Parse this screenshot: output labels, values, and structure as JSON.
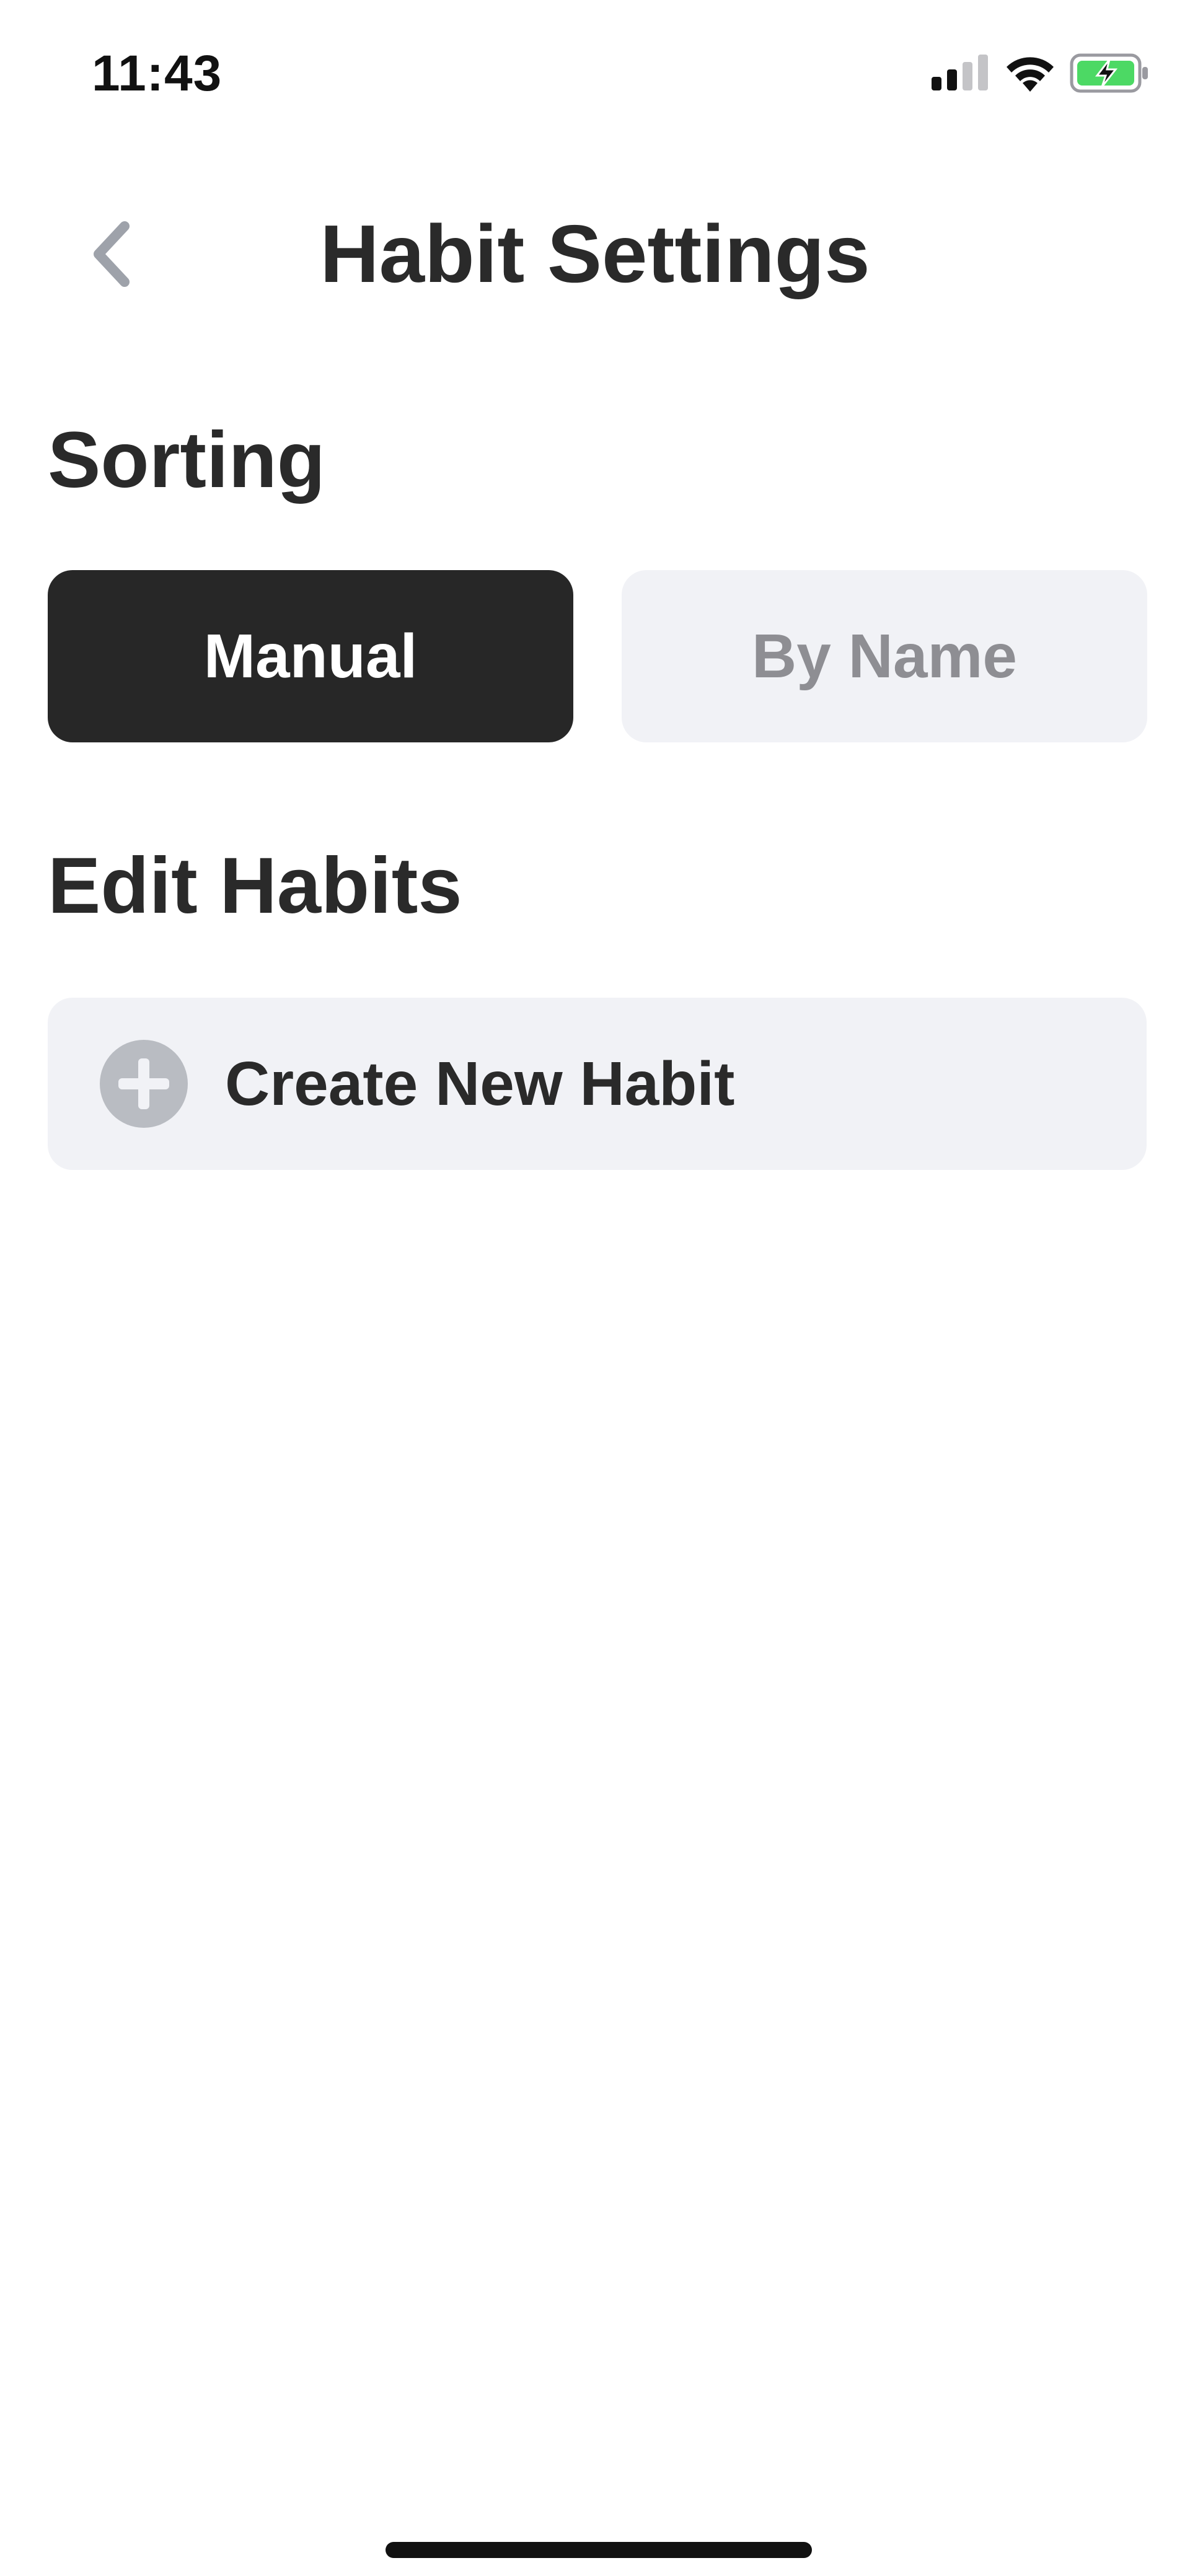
{
  "status_bar": {
    "time": "11:43",
    "icons": [
      "signal-icon",
      "wifi-icon",
      "battery-charging-icon"
    ],
    "battery_color": "#4cd964"
  },
  "header": {
    "title": "Habit Settings",
    "back_icon": "chevron-left-icon"
  },
  "sorting": {
    "title": "Sorting",
    "options": [
      {
        "label": "Manual",
        "selected": true
      },
      {
        "label": "By Name",
        "selected": false
      }
    ]
  },
  "edit_habits": {
    "title": "Edit Habits",
    "create_label": "Create New Habit",
    "create_icon": "plus-circle-icon"
  },
  "colors": {
    "selected_bg": "#272727",
    "unselected_bg": "#f1f2f6",
    "unselected_text": "#8e8e93",
    "text_primary": "#2a2a2a"
  }
}
